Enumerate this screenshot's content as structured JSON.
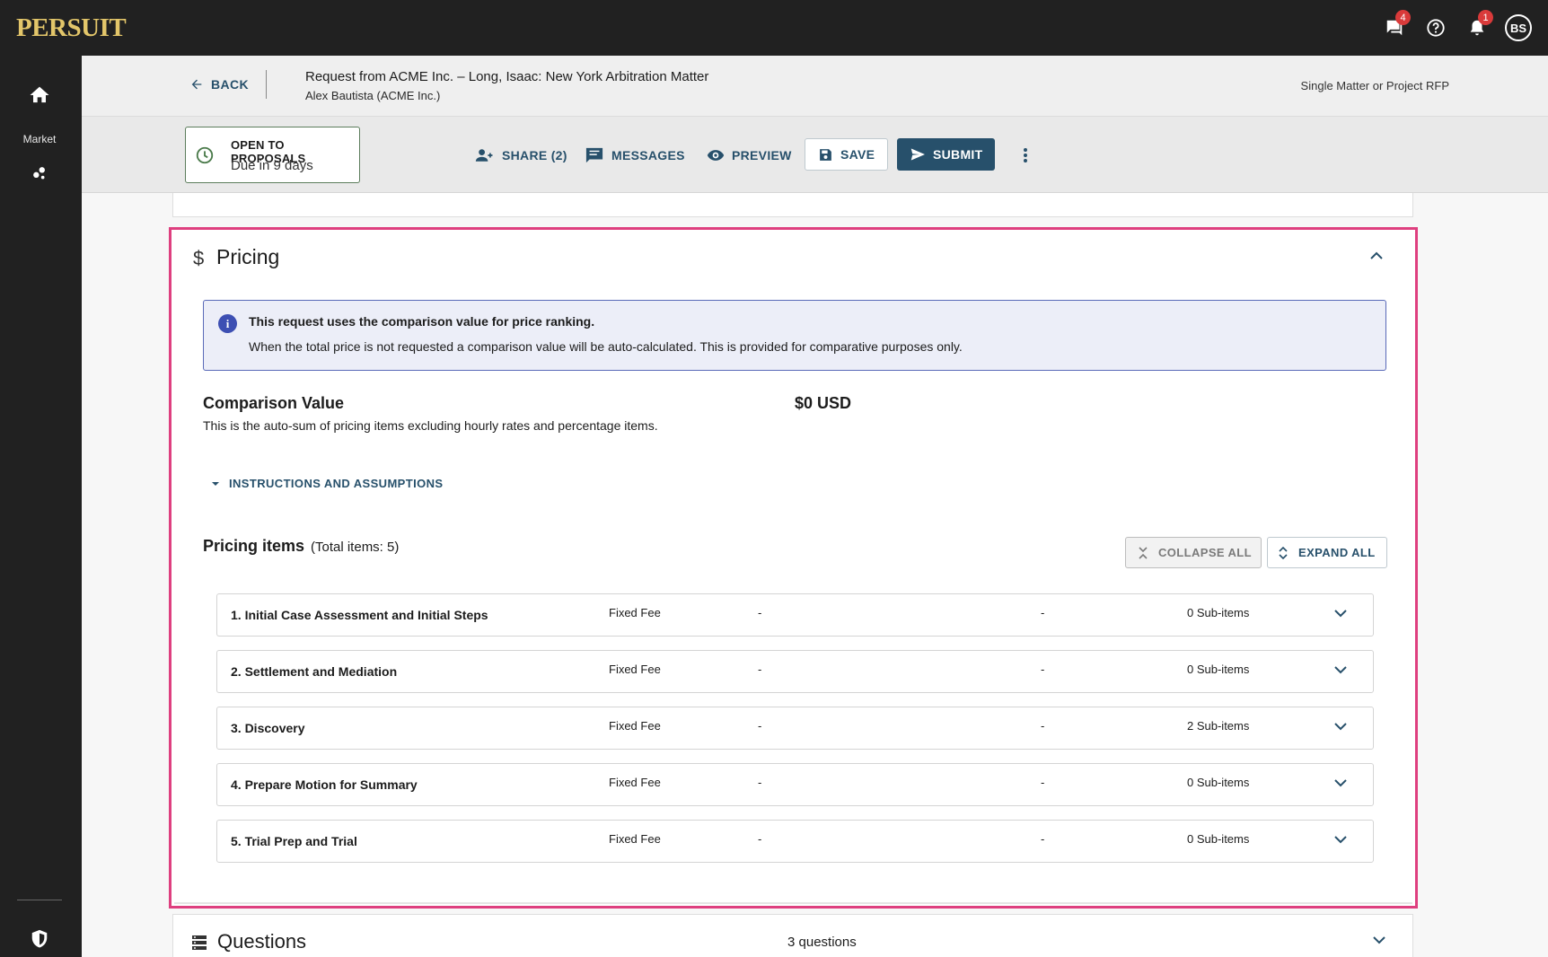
{
  "app": {
    "logo": "PERSUIT"
  },
  "topbar": {
    "messages_badge": "4",
    "notifications_badge": "1",
    "avatar_initials": "BS"
  },
  "sidebar": {
    "items": [
      {
        "icon": "home-icon"
      },
      {
        "label": "Market",
        "icon": "market-icon"
      },
      {
        "icon": "shield-icon"
      }
    ]
  },
  "header": {
    "back_label": "BACK",
    "title": "Request from ACME Inc. – Long, Isaac: New York Arbitration Matter",
    "subtitle": "Alex Bautista (ACME Inc.)",
    "rfp_type": "Single Matter or Project RFP"
  },
  "actionbar": {
    "status_title": "OPEN TO PROPOSALS",
    "status_due": "Due in 9 days",
    "share_label": "SHARE (2)",
    "messages_label": "MESSAGES",
    "preview_label": "PREVIEW",
    "save_label": "SAVE",
    "submit_label": "SUBMIT"
  },
  "pricing": {
    "title": "Pricing",
    "info_heading": "This request uses the comparison value for price ranking.",
    "info_body": "When the total price is not requested a comparison value will be auto-calculated. This is provided for comparative purposes only.",
    "comparison_label": "Comparison Value",
    "comparison_desc": "This is the auto-sum of pricing items excluding hourly rates and percentage items.",
    "comparison_value": "$0 USD",
    "instructions_label": "INSTRUCTIONS AND ASSUMPTIONS",
    "items_title": "Pricing items",
    "items_count": "(Total items: 5)",
    "collapse_all_label": "COLLAPSE ALL",
    "expand_all_label": "EXPAND ALL",
    "items": [
      {
        "name": "1. Initial Case Assessment and Initial Steps",
        "type": "Fixed Fee",
        "col1": "-",
        "col2": "-",
        "subitems": "0 Sub-items"
      },
      {
        "name": "2. Settlement and Mediation",
        "type": "Fixed Fee",
        "col1": "-",
        "col2": "-",
        "subitems": "0 Sub-items"
      },
      {
        "name": "3. Discovery",
        "type": "Fixed Fee",
        "col1": "-",
        "col2": "-",
        "subitems": "2 Sub-items"
      },
      {
        "name": "4. Prepare Motion for Summary",
        "type": "Fixed Fee",
        "col1": "-",
        "col2": "-",
        "subitems": "0 Sub-items"
      },
      {
        "name": "5. Trial Prep and Trial",
        "type": "Fixed Fee",
        "col1": "-",
        "col2": "-",
        "subitems": "0 Sub-items"
      }
    ]
  },
  "questions": {
    "title": "Questions",
    "count": "3 questions"
  },
  "colors": {
    "accent": "#27506b",
    "highlight_border": "#de3f7f",
    "info_icon": "#3d4fb3",
    "logo": "#e3c66a"
  }
}
